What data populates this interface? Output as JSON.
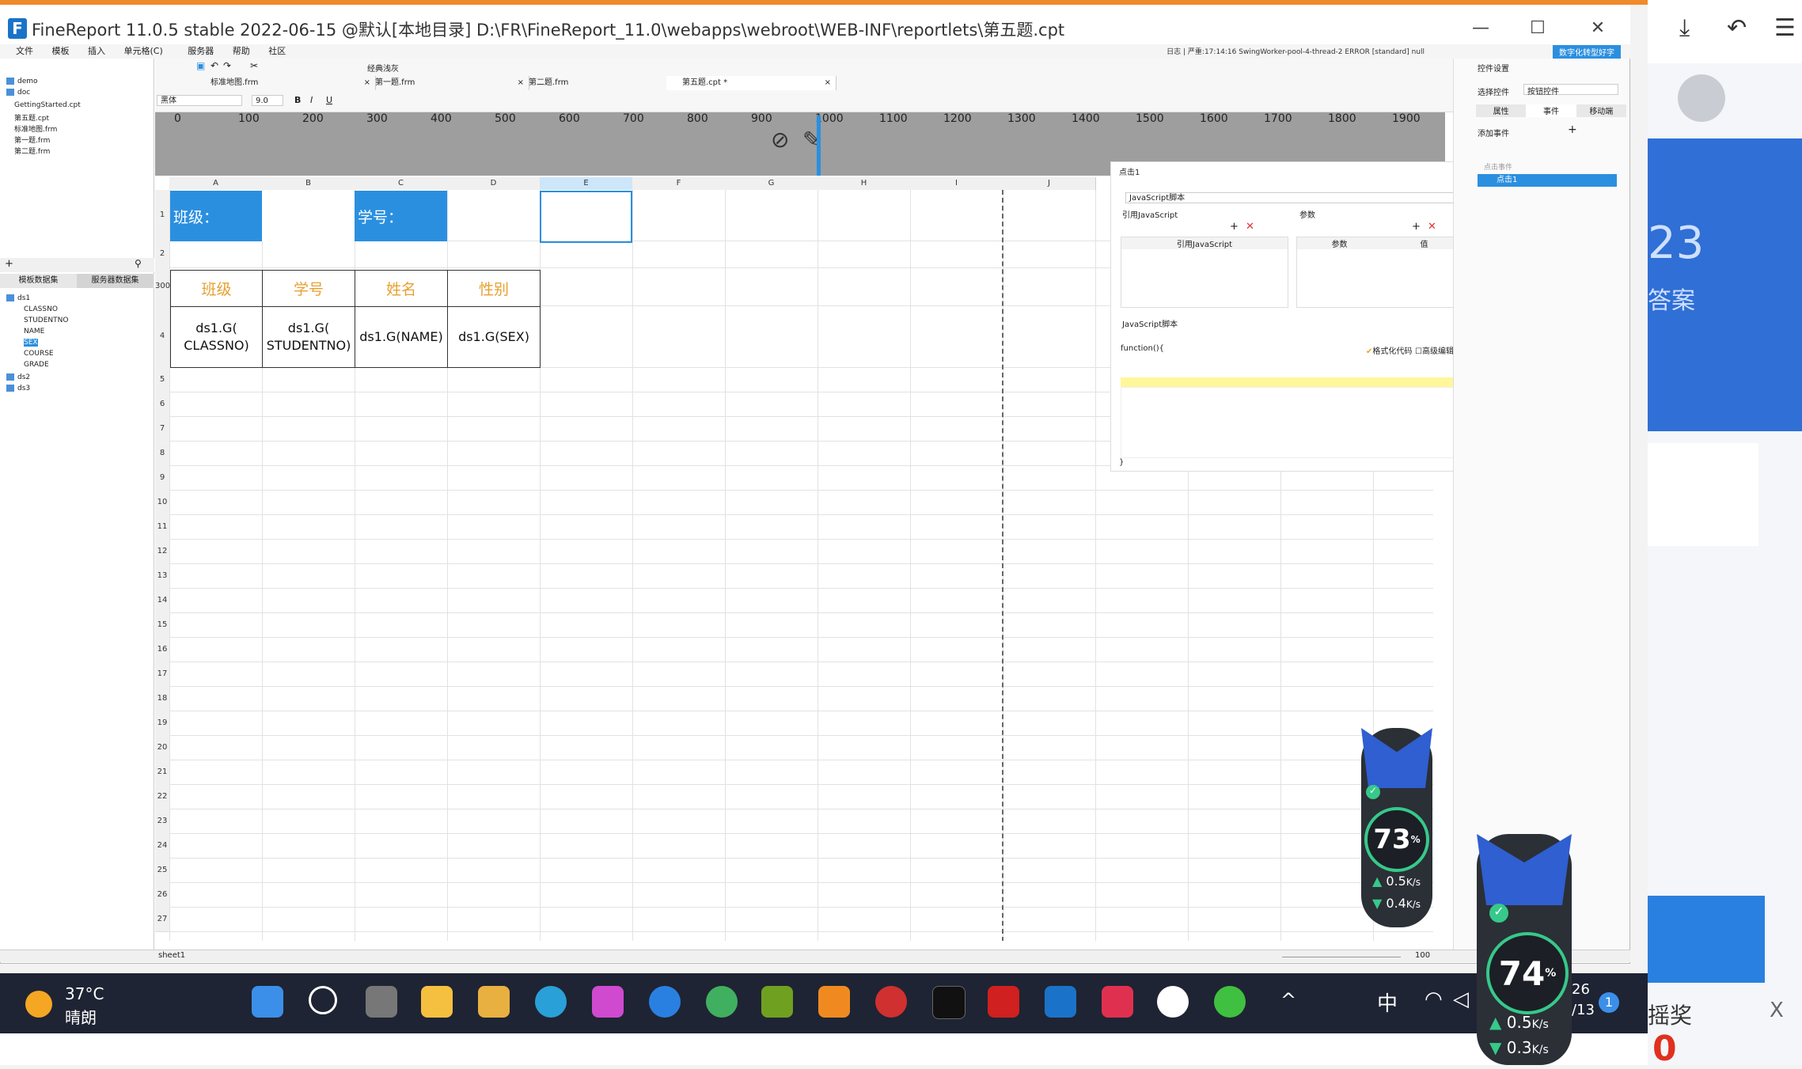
{
  "window": {
    "title": "FineReport 11.0.5 stable 2022-06-15 @默认[本地目录]    D:\\FR\\FineReport_11.0\\webapps\\webroot\\WEB-INF\\reportlets\\第五题.cpt",
    "minimize": "—",
    "maximize": "☐",
    "close": "✕"
  },
  "menu": [
    "文件",
    "模板",
    "插入",
    "单元格(C)",
    "服务器",
    "帮助",
    "社区"
  ],
  "log_line": "日志 | 严重:17:14:16 SwingWorker-pool-4-thread-2 ERROR [standard] null",
  "digital_btn": "数字化转型好字",
  "file_tree": [
    {
      "label": "demo",
      "type": "folder"
    },
    {
      "label": "doc",
      "type": "folder"
    },
    {
      "label": "GettingStarted.cpt",
      "type": "file"
    },
    {
      "label": "第五题.cpt",
      "type": "file"
    },
    {
      "label": "标准地图.frm",
      "type": "file"
    },
    {
      "label": "第一题.frm",
      "type": "file"
    },
    {
      "label": "第二题.frm",
      "type": "file"
    }
  ],
  "dataset_tabs": [
    "模板数据集",
    "服务器数据集"
  ],
  "datasets": [
    {
      "label": "ds1",
      "level": 0
    },
    {
      "label": "CLASSNO",
      "level": 1
    },
    {
      "label": "STUDENTNO",
      "level": 1
    },
    {
      "label": "NAME",
      "level": 1
    },
    {
      "label": "SEX",
      "level": 1
    },
    {
      "label": "COURSE",
      "level": 1
    },
    {
      "label": "GRADE",
      "level": 1
    },
    {
      "label": "ds2",
      "level": 0
    },
    {
      "label": "ds3",
      "level": 0
    }
  ],
  "toolbar": {
    "style_label": "经典浅灰",
    "font": "黑体",
    "font_size": "9.0"
  },
  "doc_tabs": [
    {
      "label": "标准地图.frm",
      "close": "×"
    },
    {
      "label": "第一题.frm",
      "close": "×"
    },
    {
      "label": "第二题.frm",
      "close": "×"
    },
    {
      "label": "第五题.cpt *",
      "close": "×"
    }
  ],
  "ruler_ticks": [
    "0",
    "100",
    "200",
    "300",
    "400",
    "500",
    "600",
    "700",
    "800",
    "900",
    "1000",
    "1100",
    "1200",
    "1300",
    "1400",
    "1500",
    "1600",
    "1700",
    "1800",
    "1900"
  ],
  "columns": [
    "A",
    "B",
    "C",
    "D",
    "E",
    "F",
    "G",
    "H",
    "I",
    "J"
  ],
  "rows": [
    "1",
    "2",
    "3",
    "4",
    "5",
    "6",
    "7",
    "8",
    "9",
    "10",
    "11",
    "12",
    "13",
    "14",
    "15",
    "16",
    "17",
    "18",
    "19",
    "20",
    "21",
    "22",
    "23",
    "24",
    "25",
    "26",
    "27"
  ],
  "row3_prefix": "300",
  "cells": {
    "class_label": "班级：",
    "student_label": "学号：",
    "headers": [
      "班级",
      "学号",
      "姓名",
      "性别"
    ],
    "data": [
      "ds1.G(\nCLASSNO)",
      "ds1.G(\nSTUDENTNO)",
      "ds1.G(NAME)",
      "ds1.G(SEX)"
    ]
  },
  "event_panel": {
    "title": "点击1",
    "type": "JavaScript脚本",
    "ref_label": "引用JavaScript",
    "param_label": "参数",
    "col_ref": "引用JavaScript",
    "col_param": "参数",
    "col_value": "值",
    "script_label": "JavaScript脚本",
    "func_line": "function(){",
    "format_code": "格式化代码",
    "advanced_edit": "高级编辑",
    "end_brace": "}"
  },
  "right_panel": {
    "title": "控件设置",
    "select_label": "选择控件",
    "select_value": "按钮控件",
    "tabs": [
      "属性",
      "事件",
      "移动端"
    ],
    "add_event": "添加事件",
    "event_group": "点击事件",
    "event_item": "点击1"
  },
  "statusbar": {
    "sheet": "sheet1",
    "zoom": "100"
  },
  "taskbar": {
    "temp": "37°C",
    "weather": "晴朗",
    "ime": "中",
    "date_a": "26",
    "date_b": "/13",
    "notify": "1"
  },
  "widget1": {
    "percent": "73",
    "unit": "%",
    "up": "0.5",
    "down": "0.4",
    "rate_unit": "K/s"
  },
  "widget2": {
    "percent": "74",
    "unit": "%",
    "up": "0.5",
    "down": "0.3",
    "rate_unit": "K/s"
  },
  "bg_app": {
    "big_num": "23",
    "answer": "答案",
    "prize": "摇奖",
    "close": "X",
    "bottom_num": "0"
  },
  "colors": {
    "accent": "#2b8fe0",
    "header_text": "#e8a030",
    "taskbar": "#1e2433"
  }
}
